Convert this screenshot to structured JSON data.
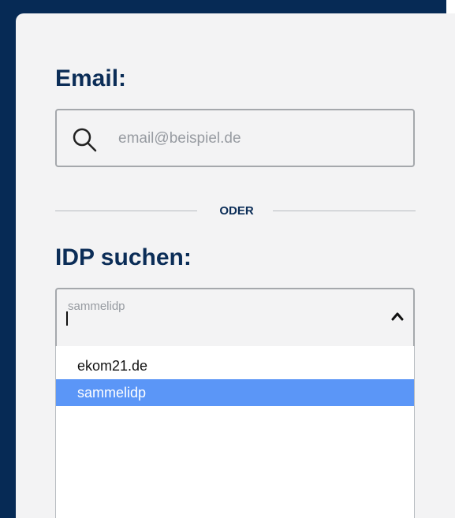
{
  "login": {
    "email_label": "Email:",
    "email_placeholder": "email@beispiel.de",
    "divider_text": "ODER",
    "idp_label": "IDP suchen:",
    "idp_placeholder": "sammelidp",
    "options": [
      "ekom21.de",
      "sammelidp"
    ]
  },
  "icons": {
    "search": "search-icon",
    "chevron": "chevron-up-icon"
  },
  "colors": {
    "background": "#062a55",
    "card": "#f3f3f4",
    "heading": "#0b2d57",
    "selected_option": "#5b96f7"
  }
}
